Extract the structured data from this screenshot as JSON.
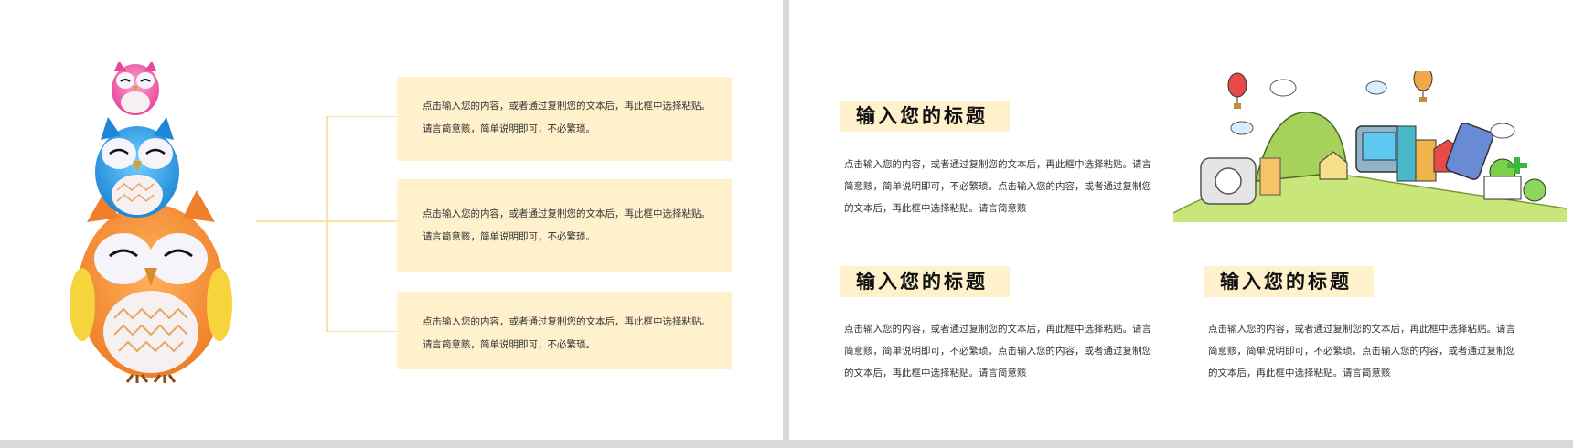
{
  "left_slide": {
    "boxes": [
      {
        "text": "点击输入您的内容，或者通过复制您的文本后，再此框中选择粘贴。请言简意赅，简单说明即可，不必繁琐。"
      },
      {
        "text": "点击输入您的内容，或者通过复制您的文本后，再此框中选择粘贴。请言简意赅，简单说明即可，不必繁琐。"
      },
      {
        "text": "点击输入您的内容，或者通过复制您的文本后，再此框中选择粘贴。请言简意赅，简单说明即可，不必繁琐。"
      }
    ]
  },
  "right_slide": {
    "sections": [
      {
        "title": "输入您的标题",
        "body": "点击输入您的内容，或者通过复制您的文本后，再此框中选择粘贴。请言简意赅，简单说明即可，不必繁琐。点击输入您的内容，或者通过复制您的文本后，再此框中选择粘贴。请言简意赅"
      },
      {
        "title": "输入您的标题",
        "body": "点击输入您的内容，或者通过复制您的文本后，再此框中选择粘贴。请言简意赅，简单说明即可，不必繁琐。点击输入您的内容，或者通过复制您的文本后，再此框中选择粘贴。请言简意赅"
      },
      {
        "title": "输入您的标题",
        "body": "点击输入您的内容，或者通过复制您的文本后，再此框中选择粘贴。请言简意赅，简单说明即可，不必繁琐。点击输入您的内容，或者通过复制您的文本后，再此框中选择粘贴。请言简意赅"
      }
    ]
  },
  "colors": {
    "highlight": "#fff1cc",
    "connector": "#f3dc8a",
    "background": "#ffffff",
    "divider": "#d9d9d9"
  },
  "icons": [
    "owl-stack-illustration",
    "cartoon-city-illustration"
  ]
}
